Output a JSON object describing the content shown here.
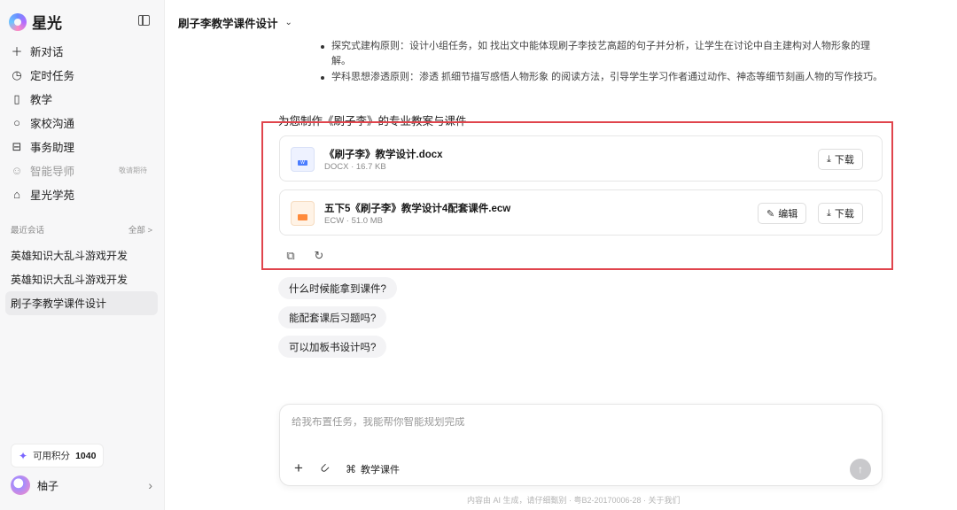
{
  "sidebar": {
    "brand": "星光",
    "nav": [
      {
        "label": "新对话",
        "icon": "plus-icon"
      },
      {
        "label": "定时任务",
        "icon": "clock-icon"
      },
      {
        "label": "教学",
        "icon": "book-icon"
      },
      {
        "label": "家校沟通",
        "icon": "chat-icon"
      },
      {
        "label": "事务助理",
        "icon": "briefcase-icon"
      },
      {
        "label": "智能导师",
        "icon": "bot-icon",
        "badge": "敬请期待",
        "disabled": true
      },
      {
        "label": "星光学苑",
        "icon": "graduation-cap-icon"
      }
    ],
    "recent_title": "最近会话",
    "recent_all": "全部 >",
    "recent": [
      "英雄知识大乱斗游戏开发",
      "英雄知识大乱斗游戏开发",
      "刷子李教学课件设计"
    ],
    "points_label": "可用积分",
    "points_value": "1040",
    "user_name": "柚子"
  },
  "main": {
    "title": "刷子李教学课件设计",
    "bullets": [
      "探究式建构原则：设计小组任务，如 找出文中能体现刷子李技艺高超的句子并分析，让学生在讨论中自主建构对人物形象的理解。",
      "学科思想渗透原则：渗透 抓细节描写感悟人物形象 的阅读方法，引导学生学习作者通过动作、神态等细节刻画人物的写作技巧。"
    ],
    "intro": "为您制作《刷子李》的专业教案与课件",
    "files": [
      {
        "name": "《刷子李》教学设计.docx",
        "meta": "DOCX · 16.7 KB",
        "download": "下载"
      },
      {
        "name": "五下5《刷子李》教学设计4配套课件.ecw",
        "meta": "ECW · 51.0 MB",
        "edit": "编辑",
        "download": "下载"
      }
    ],
    "suggestions": [
      "什么时候能拿到课件?",
      "能配套课后习题吗?",
      "可以加板书设计吗?"
    ],
    "composer": {
      "placeholder": "给我布置任务，我能帮你智能规划完成",
      "skill": "教学课件"
    },
    "footer": "内容由 AI 生成，请仔细甄别 · 粤B2-20170006-28 · 关于我们"
  }
}
